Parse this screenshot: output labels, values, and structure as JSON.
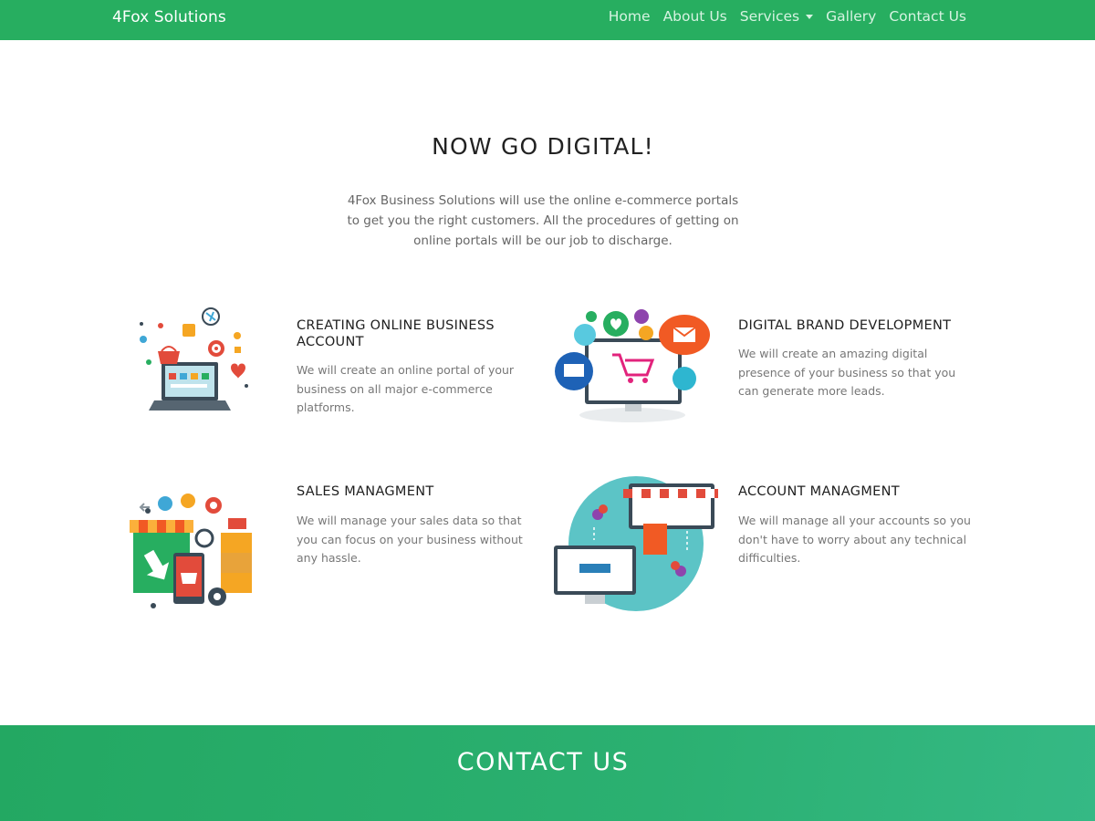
{
  "navbar": {
    "brand": "4Fox Solutions",
    "links": [
      {
        "label": "Home"
      },
      {
        "label": "About Us"
      },
      {
        "label": "Services"
      },
      {
        "label": "Gallery"
      },
      {
        "label": "Contact Us"
      }
    ]
  },
  "hero": {
    "title": "NOW GO DIGITAL!",
    "text": "4Fox Business Solutions will use the online e-commerce portals to get you the right customers. All the procedures of getting on online portals will be our job to discharge."
  },
  "features": [
    {
      "title": "CREATING ONLINE BUSINESS ACCOUNT",
      "text": "We will create an online portal of your business on all major e-commerce platforms.",
      "icon": "laptop-ecommerce-icon"
    },
    {
      "title": "DIGITAL BRAND DEVELOPMENT",
      "text": "We will create an amazing digital presence of your business so that you can generate more leads.",
      "icon": "monitor-social-icon"
    },
    {
      "title": "SALES MANAGMENT",
      "text": "We will manage your sales data so that you can focus on your business without any hassle.",
      "icon": "store-sales-icon"
    },
    {
      "title": "ACCOUNT MANAGMENT",
      "text": "We will manage all your accounts so you don't have to worry about any technical difficulties.",
      "icon": "shop-network-icon"
    }
  ],
  "contact": {
    "title": "CONTACT US"
  },
  "colors": {
    "brand_green": "#27ae60",
    "text_dark": "#222222",
    "text_muted": "#777777"
  }
}
